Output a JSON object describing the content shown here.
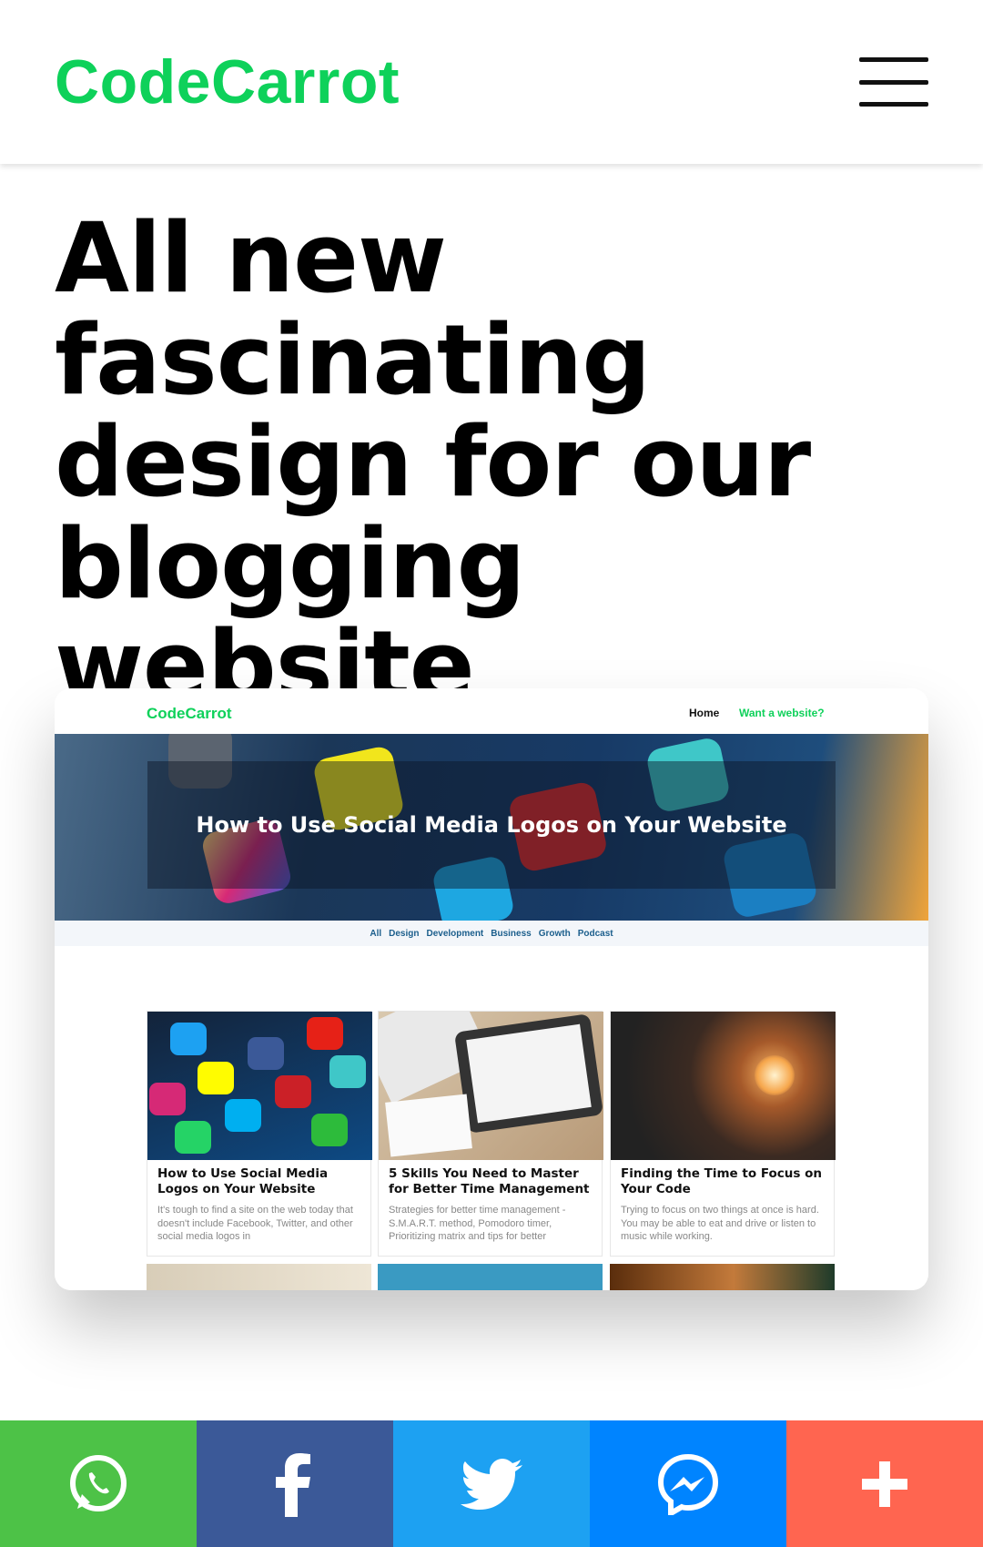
{
  "header": {
    "logo": "CodeCarrot",
    "menu_icon": "hamburger-menu-icon"
  },
  "article": {
    "headline": "All new fascinating design for our blogging website"
  },
  "preview": {
    "nav": {
      "logo": "CodeCarrot",
      "links": [
        "Home",
        "Want a website?"
      ]
    },
    "hero": {
      "title": "How to Use Social Media Logos on Your Website"
    },
    "categories": [
      "All",
      "Design",
      "Development",
      "Business",
      "Growth",
      "Podcast"
    ],
    "cards": [
      {
        "title": "How to Use Social Media Logos on Your Website",
        "excerpt": "It's tough to find a site on the web today that doesn't include Facebook, Twitter, and other social media logos in"
      },
      {
        "title": "5 Skills You Need to Master for Better Time Management",
        "excerpt": "Strategies for better time management - S.M.A.R.T. method, Pomodoro timer, Prioritizing matrix and tips for better"
      },
      {
        "title": "Finding the Time to Focus on Your Code",
        "excerpt": "Trying to focus on two things at once is hard. You may be able to eat and drive or listen to music while working."
      }
    ]
  },
  "share_bar": {
    "buttons": [
      {
        "name": "whatsapp",
        "icon": "whatsapp-icon",
        "color": "#4dc247"
      },
      {
        "name": "facebook",
        "icon": "facebook-icon",
        "color": "#3b5998"
      },
      {
        "name": "twitter",
        "icon": "twitter-icon",
        "color": "#1da1f2"
      },
      {
        "name": "messenger",
        "icon": "messenger-icon",
        "color": "#0084ff"
      },
      {
        "name": "more",
        "icon": "plus-icon",
        "color": "#ff6550"
      }
    ]
  },
  "colors": {
    "brand": "#0ed15a",
    "text": "#000000"
  }
}
